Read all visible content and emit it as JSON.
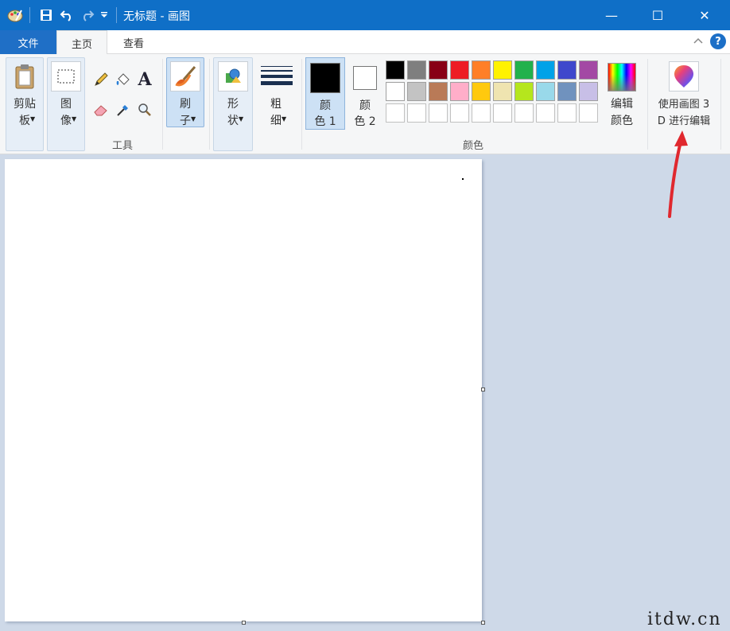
{
  "window": {
    "title": "无标题 - 画图",
    "minimize_glyph": "—",
    "maximize_glyph": "☐",
    "close_glyph": "✕"
  },
  "tabs": {
    "file": "文件",
    "home": "主页",
    "view": "查看"
  },
  "ribbon": {
    "clipboard": "剪贴\n板",
    "image": "图\n像",
    "tools_group": "工具",
    "brushes": "刷\n子",
    "shapes": "形\n状",
    "size": "粗\n细",
    "color1": "颜\n色 1",
    "color2": "颜\n色 2",
    "edit_colors": "编辑\n颜色",
    "colors_group": "颜色",
    "paint3d": "使用画图 3\nD 进行编辑"
  },
  "colors": {
    "color1": "#000000",
    "color2": "#ffffff",
    "palette": [
      "#000000",
      "#7f7f7f",
      "#880015",
      "#ed1c24",
      "#ff7f27",
      "#fff200",
      "#22b14c",
      "#00a2e8",
      "#3f48cc",
      "#a349a4",
      "#ffffff",
      "#c3c3c3",
      "#b97a57",
      "#ffaec9",
      "#ffc90e",
      "#efe4b0",
      "#b5e61d",
      "#99d9ea",
      "#7092be",
      "#c8bfe7",
      "#ffffff",
      "#ffffff",
      "#ffffff",
      "#ffffff",
      "#ffffff",
      "#ffffff",
      "#ffffff",
      "#ffffff",
      "#ffffff",
      "#ffffff"
    ],
    "titlebar": "#0f6fc7",
    "annotation_arrow": "#e0282e"
  },
  "watermark": "itdw.cn"
}
